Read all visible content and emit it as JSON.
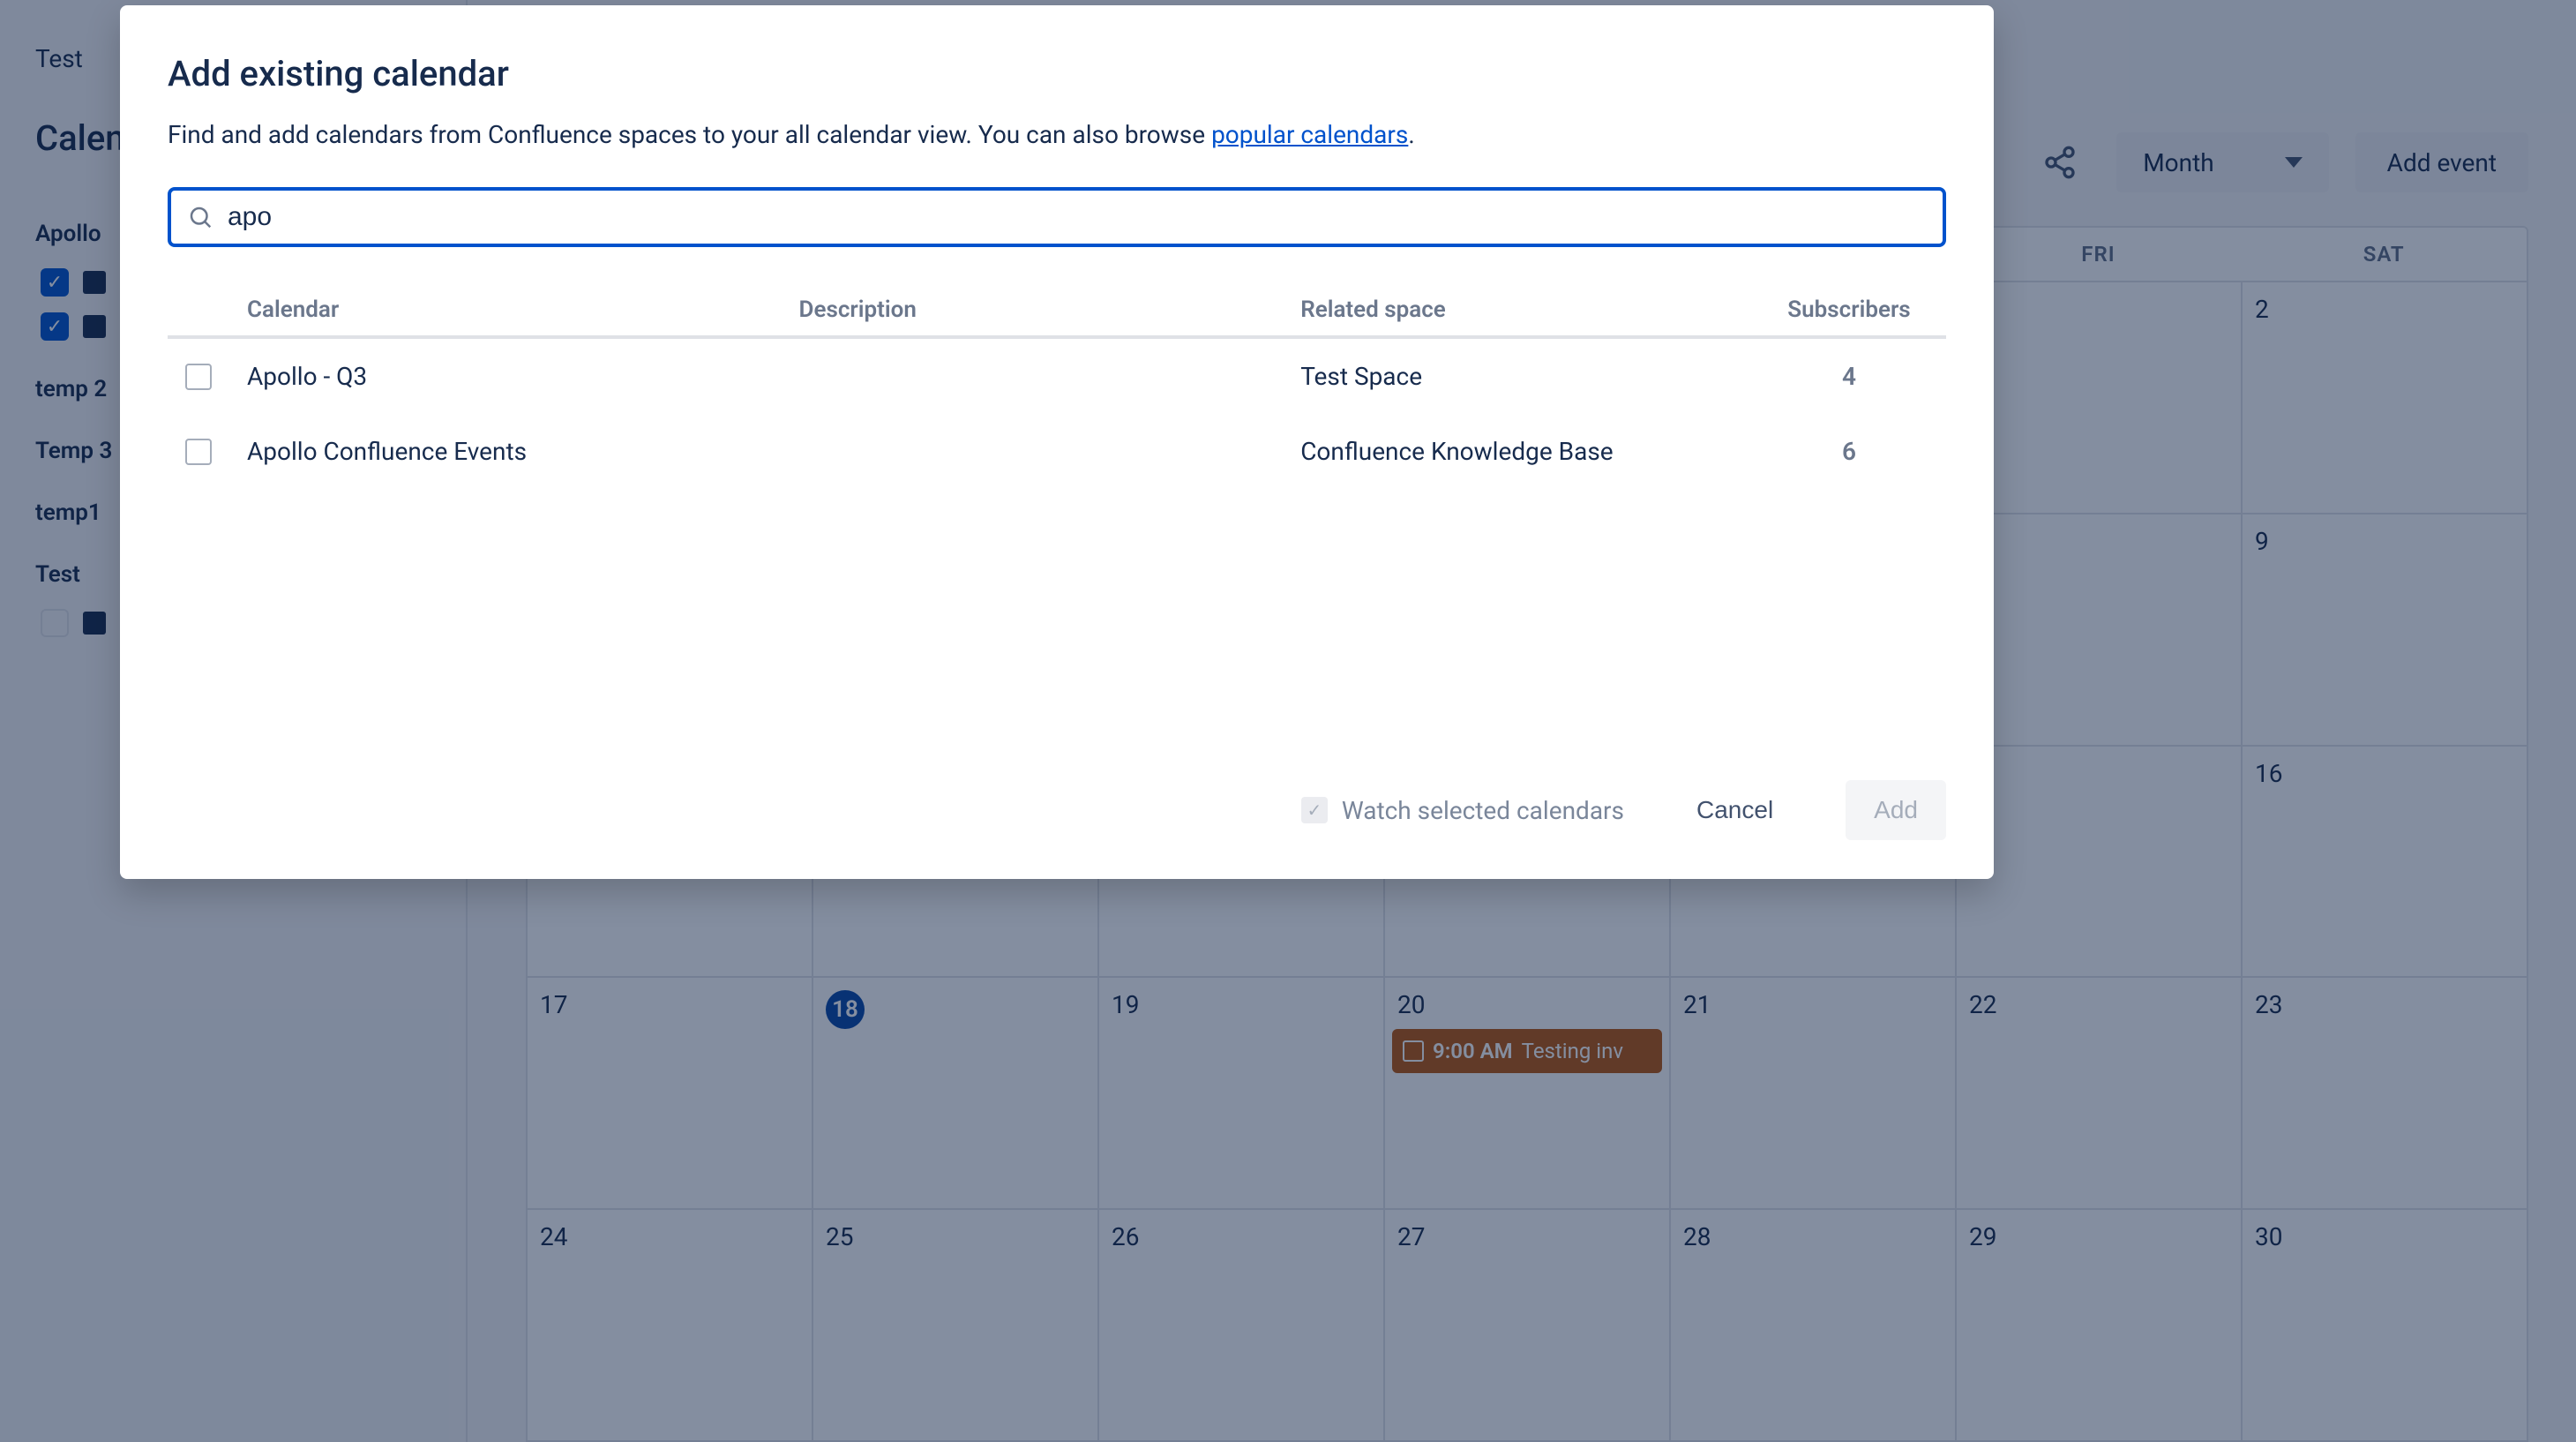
{
  "sidebar": {
    "breadcrumb": "Test",
    "page_title": "Calen",
    "groups": [
      {
        "name": "Apollo",
        "items": [
          {
            "checked": true
          },
          {
            "checked": true
          }
        ]
      },
      {
        "name": "temp 2",
        "items": []
      },
      {
        "name": "Temp 3",
        "items": []
      },
      {
        "name": "temp1",
        "items": []
      },
      {
        "name": "Test",
        "items": [
          {
            "checked": false
          }
        ]
      }
    ]
  },
  "toolbar": {
    "view_label": "Month",
    "add_event_label": "Add event"
  },
  "calendar": {
    "day_headers": [
      "",
      "",
      "",
      "",
      "",
      "FRI",
      "SAT"
    ],
    "weeks": [
      [
        null,
        null,
        null,
        null,
        null,
        null,
        "2"
      ],
      [
        null,
        null,
        null,
        null,
        null,
        null,
        "9"
      ],
      [
        null,
        null,
        null,
        null,
        null,
        null,
        "16"
      ],
      [
        "17",
        "18",
        "19",
        "20",
        "21",
        "22",
        "23"
      ],
      [
        "24",
        "25",
        "26",
        "27",
        "28",
        "29",
        "30"
      ]
    ],
    "today_index": {
      "week": 3,
      "day": 1
    },
    "events": [
      {
        "week": 3,
        "day": 3,
        "time": "9:00 AM",
        "title": "Testing inv"
      }
    ]
  },
  "modal": {
    "title": "Add existing calendar",
    "description_prefix": "Find and add calendars from Confluence spaces to your all calendar view. You can also browse ",
    "description_link": "popular calendars",
    "description_suffix": ".",
    "search_value": "apo",
    "columns": {
      "calendar": "Calendar",
      "description": "Description",
      "space": "Related space",
      "subscribers": "Subscribers"
    },
    "results": [
      {
        "name": "Apollo - Q3",
        "description": "",
        "space": "Test Space",
        "subscribers": "4"
      },
      {
        "name": "Apollo Confluence Events",
        "description": "",
        "space": "Confluence Knowledge Base",
        "subscribers": "6"
      }
    ],
    "watch_label": "Watch selected calendars",
    "cancel_label": "Cancel",
    "add_label": "Add"
  }
}
